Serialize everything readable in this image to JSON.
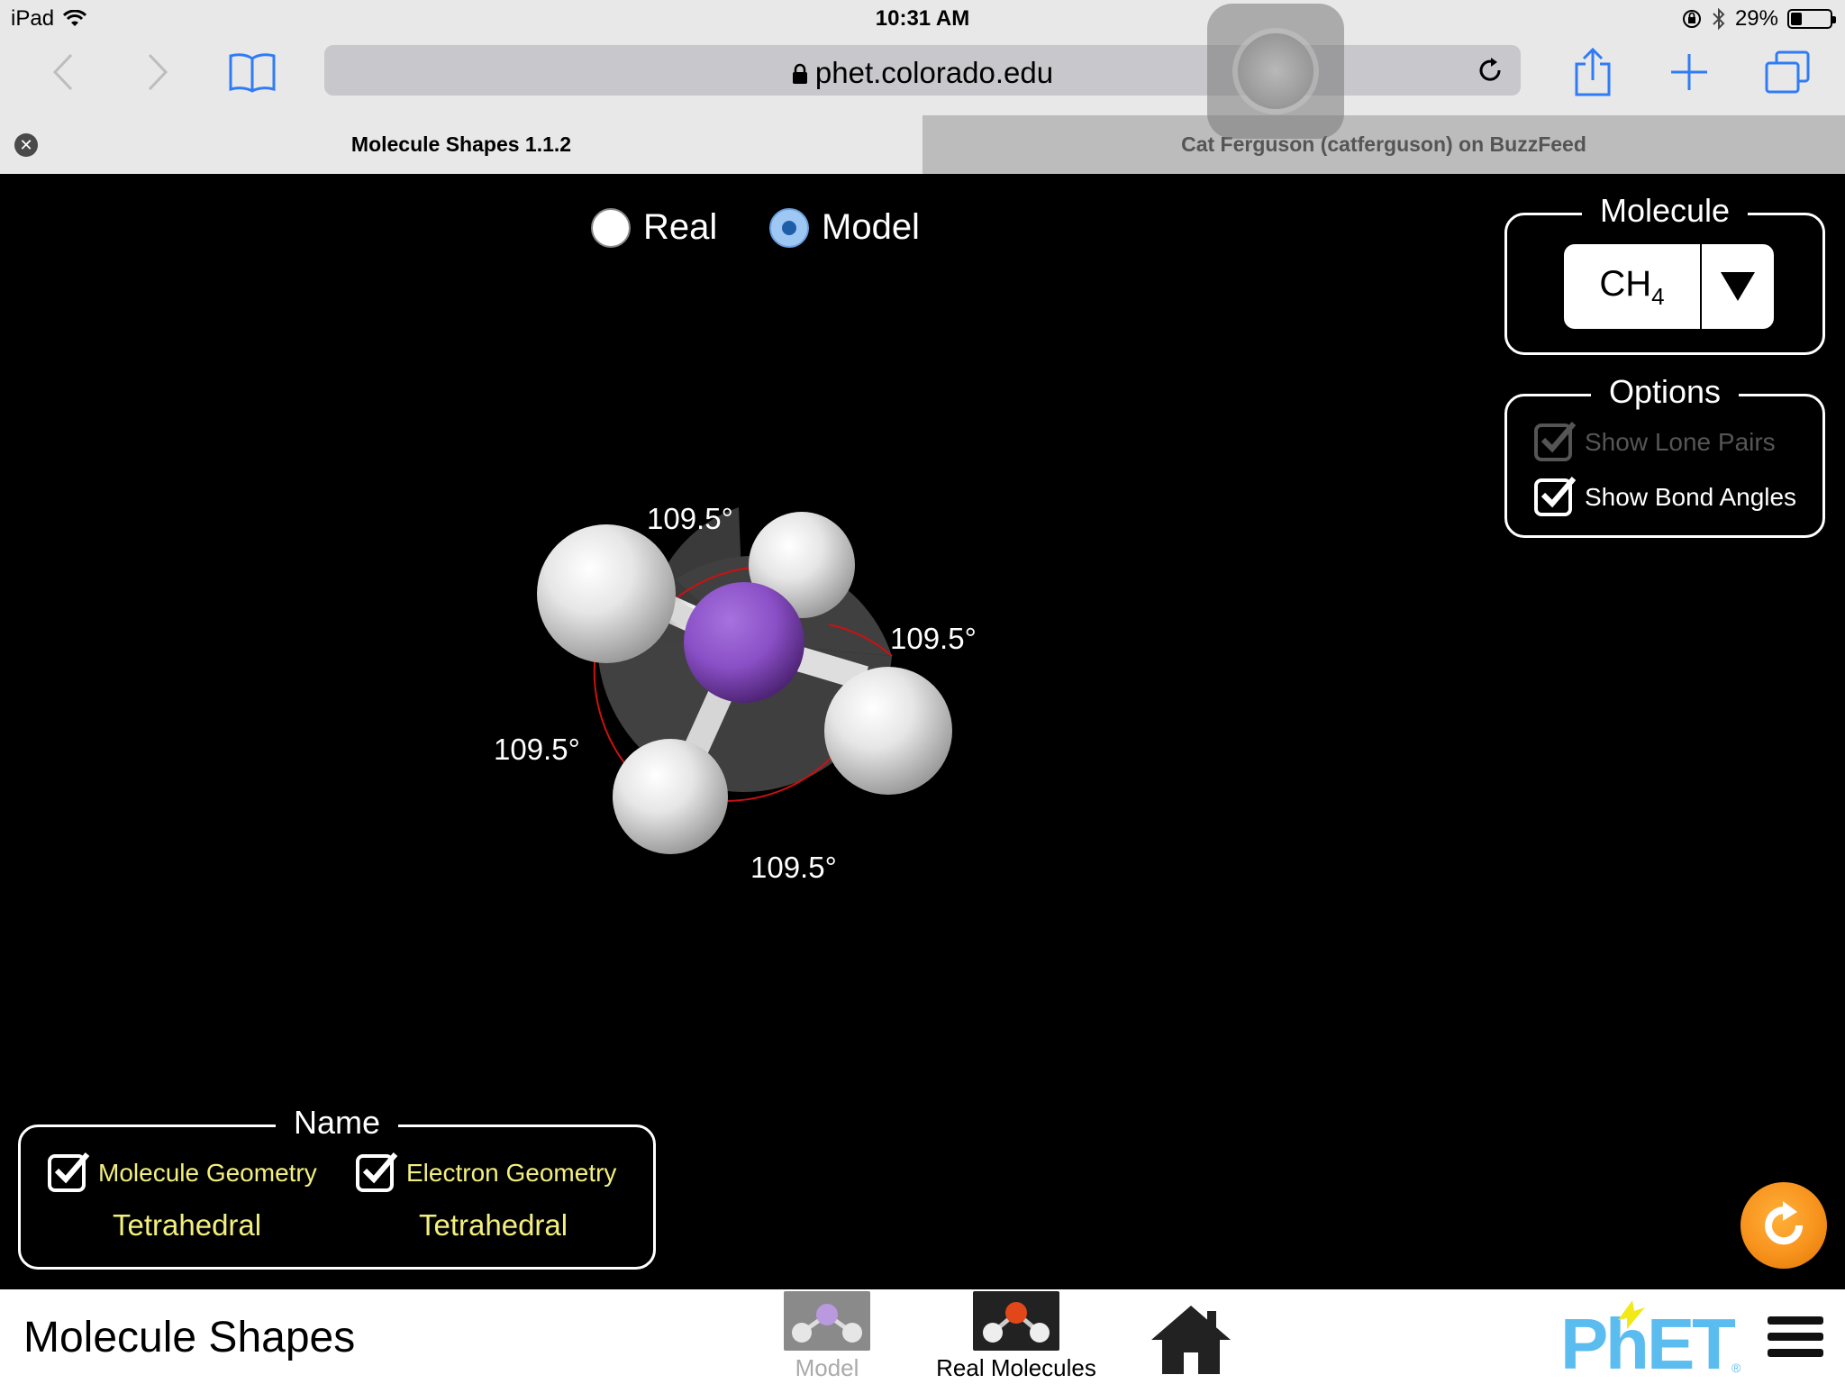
{
  "status_bar": {
    "device": "iPad",
    "time": "10:31 AM",
    "battery": "29%",
    "battery_level": 0.29
  },
  "browser": {
    "url": "phet.colorado.edu",
    "tabs": [
      {
        "title": "Molecule Shapes 1.1.2",
        "active": true
      },
      {
        "title": "Cat Ferguson (catferguson) on BuzzFeed",
        "active": false
      }
    ]
  },
  "sim": {
    "mode": {
      "options": [
        "Real",
        "Model"
      ],
      "selected": "Model"
    },
    "molecule_panel": {
      "title": "Molecule",
      "formula_main": "CH",
      "formula_sub": "4"
    },
    "options_panel": {
      "title": "Options",
      "show_lone_pairs": {
        "label": "Show Lone Pairs",
        "checked": true,
        "enabled": false
      },
      "show_bond_angles": {
        "label": "Show Bond Angles",
        "checked": true,
        "enabled": true
      }
    },
    "bond_angles": [
      "109.5°",
      "109.5°",
      "109.5°",
      "109.5°"
    ],
    "name_panel": {
      "title": "Name",
      "molecule_geometry": {
        "label": "Molecule Geometry",
        "checked": true,
        "value": "Tetrahedral"
      },
      "electron_geometry": {
        "label": "Electron Geometry",
        "checked": true,
        "value": "Tetrahedral"
      }
    },
    "colors": {
      "central_atom": "#8a4fc6",
      "outer_atom": "#f0f0f0",
      "label_yellow": "#f3ef7c",
      "reset": "#f7931d",
      "angle_arc": "#cc1111"
    }
  },
  "navbar": {
    "title": "Molecule Shapes",
    "screens": [
      {
        "label": "Model",
        "active": false
      },
      {
        "label": "Real Molecules",
        "active": true
      }
    ],
    "home_icon": "house-icon",
    "logo_text": "PhET",
    "menu_icon": "hamburger-menu-icon"
  }
}
